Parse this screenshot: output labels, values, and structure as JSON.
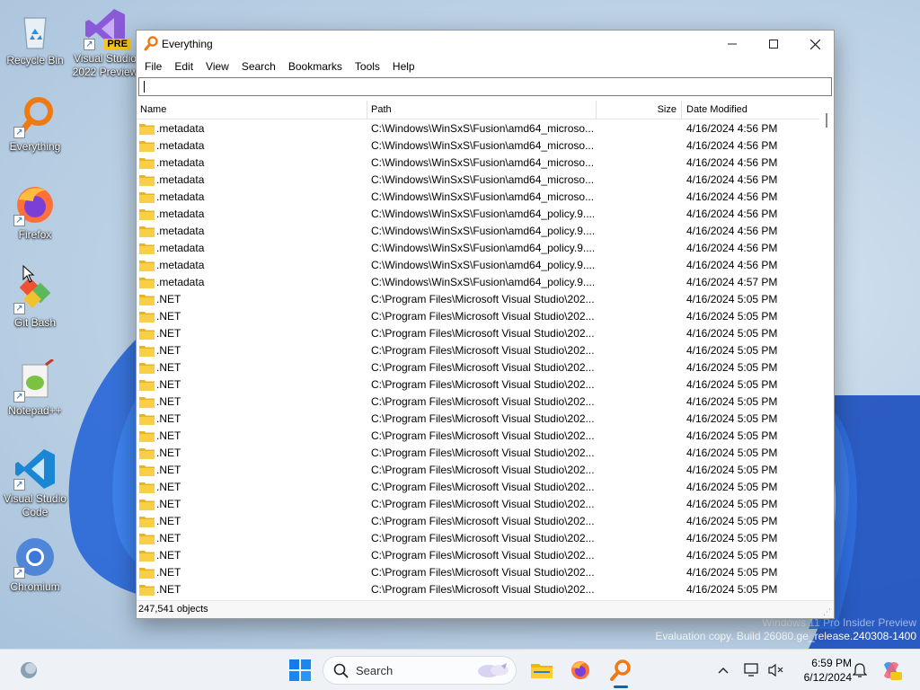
{
  "desktop": {
    "icons": [
      {
        "label": "Recycle Bin"
      },
      {
        "label": "Visual Studio 2022 Preview",
        "badge": "PRE"
      },
      {
        "label": "Everything"
      },
      {
        "label": "Firefox"
      },
      {
        "label": "Git Bash"
      },
      {
        "label": "Notepad++"
      },
      {
        "label": "Visual Studio Code"
      },
      {
        "label": "Chromium"
      }
    ],
    "watermark": {
      "line1": "Windows 11 Pro Insider Preview",
      "line2": "Evaluation copy. Build 26080.ge_release.240308-1400"
    }
  },
  "window": {
    "title": "Everything",
    "controls": {
      "minimize": "─",
      "maximize": "☐",
      "close": "✕"
    },
    "menu": [
      "File",
      "Edit",
      "View",
      "Search",
      "Bookmarks",
      "Tools",
      "Help"
    ],
    "search": {
      "value": "",
      "placeholder": ""
    },
    "columns": {
      "name": "Name",
      "path": "Path",
      "size": "Size",
      "date": "Date Modified"
    },
    "rows": [
      {
        "name": ".metadata",
        "path": "C:\\Windows\\WinSxS\\Fusion\\amd64_microso...",
        "size": "",
        "date": "4/16/2024 4:56 PM"
      },
      {
        "name": ".metadata",
        "path": "C:\\Windows\\WinSxS\\Fusion\\amd64_microso...",
        "size": "",
        "date": "4/16/2024 4:56 PM"
      },
      {
        "name": ".metadata",
        "path": "C:\\Windows\\WinSxS\\Fusion\\amd64_microso...",
        "size": "",
        "date": "4/16/2024 4:56 PM"
      },
      {
        "name": ".metadata",
        "path": "C:\\Windows\\WinSxS\\Fusion\\amd64_microso...",
        "size": "",
        "date": "4/16/2024 4:56 PM"
      },
      {
        "name": ".metadata",
        "path": "C:\\Windows\\WinSxS\\Fusion\\amd64_microso...",
        "size": "",
        "date": "4/16/2024 4:56 PM"
      },
      {
        "name": ".metadata",
        "path": "C:\\Windows\\WinSxS\\Fusion\\amd64_policy.9....",
        "size": "",
        "date": "4/16/2024 4:56 PM"
      },
      {
        "name": ".metadata",
        "path": "C:\\Windows\\WinSxS\\Fusion\\amd64_policy.9....",
        "size": "",
        "date": "4/16/2024 4:56 PM"
      },
      {
        "name": ".metadata",
        "path": "C:\\Windows\\WinSxS\\Fusion\\amd64_policy.9....",
        "size": "",
        "date": "4/16/2024 4:56 PM"
      },
      {
        "name": ".metadata",
        "path": "C:\\Windows\\WinSxS\\Fusion\\amd64_policy.9....",
        "size": "",
        "date": "4/16/2024 4:56 PM"
      },
      {
        "name": ".metadata",
        "path": "C:\\Windows\\WinSxS\\Fusion\\amd64_policy.9....",
        "size": "",
        "date": "4/16/2024 4:57 PM"
      },
      {
        "name": ".NET",
        "path": "C:\\Program Files\\Microsoft Visual Studio\\202...",
        "size": "",
        "date": "4/16/2024 5:05 PM"
      },
      {
        "name": ".NET",
        "path": "C:\\Program Files\\Microsoft Visual Studio\\202...",
        "size": "",
        "date": "4/16/2024 5:05 PM"
      },
      {
        "name": ".NET",
        "path": "C:\\Program Files\\Microsoft Visual Studio\\202...",
        "size": "",
        "date": "4/16/2024 5:05 PM"
      },
      {
        "name": ".NET",
        "path": "C:\\Program Files\\Microsoft Visual Studio\\202...",
        "size": "",
        "date": "4/16/2024 5:05 PM"
      },
      {
        "name": ".NET",
        "path": "C:\\Program Files\\Microsoft Visual Studio\\202...",
        "size": "",
        "date": "4/16/2024 5:05 PM"
      },
      {
        "name": ".NET",
        "path": "C:\\Program Files\\Microsoft Visual Studio\\202...",
        "size": "",
        "date": "4/16/2024 5:05 PM"
      },
      {
        "name": ".NET",
        "path": "C:\\Program Files\\Microsoft Visual Studio\\202...",
        "size": "",
        "date": "4/16/2024 5:05 PM"
      },
      {
        "name": ".NET",
        "path": "C:\\Program Files\\Microsoft Visual Studio\\202...",
        "size": "",
        "date": "4/16/2024 5:05 PM"
      },
      {
        "name": ".NET",
        "path": "C:\\Program Files\\Microsoft Visual Studio\\202...",
        "size": "",
        "date": "4/16/2024 5:05 PM"
      },
      {
        "name": ".NET",
        "path": "C:\\Program Files\\Microsoft Visual Studio\\202...",
        "size": "",
        "date": "4/16/2024 5:05 PM"
      },
      {
        "name": ".NET",
        "path": "C:\\Program Files\\Microsoft Visual Studio\\202...",
        "size": "",
        "date": "4/16/2024 5:05 PM"
      },
      {
        "name": ".NET",
        "path": "C:\\Program Files\\Microsoft Visual Studio\\202...",
        "size": "",
        "date": "4/16/2024 5:05 PM"
      },
      {
        "name": ".NET",
        "path": "C:\\Program Files\\Microsoft Visual Studio\\202...",
        "size": "",
        "date": "4/16/2024 5:05 PM"
      },
      {
        "name": ".NET",
        "path": "C:\\Program Files\\Microsoft Visual Studio\\202...",
        "size": "",
        "date": "4/16/2024 5:05 PM"
      },
      {
        "name": ".NET",
        "path": "C:\\Program Files\\Microsoft Visual Studio\\202...",
        "size": "",
        "date": "4/16/2024 5:05 PM"
      },
      {
        "name": ".NET",
        "path": "C:\\Program Files\\Microsoft Visual Studio\\202...",
        "size": "",
        "date": "4/16/2024 5:05 PM"
      },
      {
        "name": ".NET",
        "path": "C:\\Program Files\\Microsoft Visual Studio\\202...",
        "size": "",
        "date": "4/16/2024 5:05 PM"
      },
      {
        "name": ".NET",
        "path": "C:\\Program Files\\Microsoft Visual Studio\\202...",
        "size": "",
        "date": "4/16/2024 5:05 PM"
      }
    ],
    "status": "247,541 objects"
  },
  "taskbar": {
    "search_placeholder": "Search",
    "apps": [
      "widgets",
      "start",
      "search",
      "file-explorer",
      "firefox",
      "everything"
    ],
    "active_app": "everything",
    "time": "6:59 PM",
    "date": "6/12/2024"
  },
  "colors": {
    "folder": "#f4c430",
    "everything_orange": "#f07a12",
    "accent": "#0067c0",
    "wallpaper": "#b8cfe3"
  }
}
